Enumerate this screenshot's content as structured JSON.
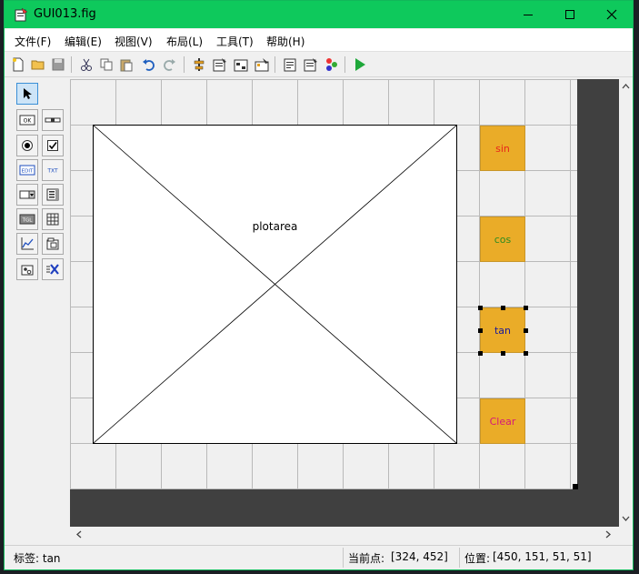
{
  "window": {
    "title": "GUI013.fig",
    "accent": "#0ec95c"
  },
  "menu": [
    "文件(F)",
    "编辑(E)",
    "视图(V)",
    "布局(L)",
    "工具(T)",
    "帮助(H)"
  ],
  "canvas": {
    "axes_label": "plotarea",
    "buttons": [
      {
        "label": "sin",
        "color": "#e8251a"
      },
      {
        "label": "cos",
        "color": "#2e8b20"
      },
      {
        "label": "tan",
        "color": "#1a1a9a",
        "selected": true
      },
      {
        "label": "Clear",
        "color": "#d4187a"
      }
    ],
    "button_bg": "#eaac28"
  },
  "status": {
    "tag": "标签: tan",
    "current_point_label": "当前点:",
    "current_point": "[324, 452]",
    "position_label": "位置:",
    "position": "[450, 151, 51, 51]"
  }
}
